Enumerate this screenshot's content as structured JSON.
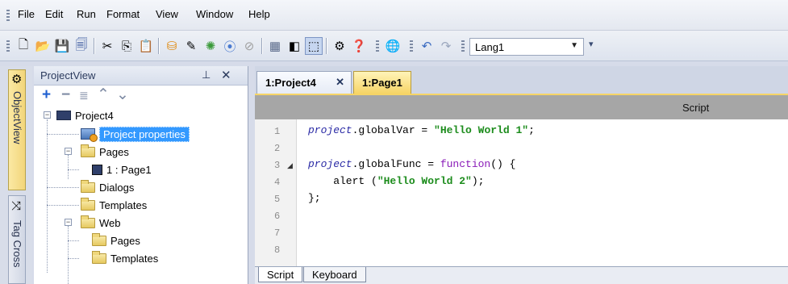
{
  "menu": [
    "File",
    "Edit",
    "Run",
    "Format",
    "View",
    "Window",
    "Help"
  ],
  "toolbar": {
    "icons": [
      "new-icon",
      "open-icon",
      "save-icon",
      "save-all-icon",
      "cut-icon",
      "copy-icon",
      "paste-icon",
      "run-icon",
      "edit-icon",
      "debug-icon",
      "play-icon",
      "stop-icon",
      "grid-icon",
      "align-icon",
      "select-icon",
      "properties-icon",
      "help-icon",
      "globe-icon",
      "undo-icon",
      "redo-icon"
    ],
    "language": "Lang1"
  },
  "sidebar": {
    "tabs": [
      "ObjectView",
      "Tag Cross"
    ]
  },
  "project_view": {
    "title": "ProjectView",
    "tree": [
      {
        "label": "Project4",
        "level": 0,
        "expanded": true,
        "icon": "monitor-icon"
      },
      {
        "label": "Project properties",
        "level": 1,
        "selected": true,
        "icon": "properties-icon"
      },
      {
        "label": "Pages",
        "level": 1,
        "expanded": true,
        "icon": "folder-icon"
      },
      {
        "label": "1 : Page1",
        "level": 2,
        "icon": "page-icon"
      },
      {
        "label": "Dialogs",
        "level": 1,
        "icon": "folder-icon"
      },
      {
        "label": "Templates",
        "level": 1,
        "icon": "folder-icon"
      },
      {
        "label": "Web",
        "level": 1,
        "expanded": true,
        "icon": "folder-icon"
      },
      {
        "label": "Pages",
        "level": 2,
        "icon": "folder-icon"
      },
      {
        "label": "Templates",
        "level": 2,
        "icon": "folder-icon"
      }
    ]
  },
  "editor": {
    "tabs": [
      {
        "label": "1:Project4",
        "active": true
      },
      {
        "label": "1:Page1",
        "active": false
      }
    ],
    "header": "Script",
    "line_numbers": [
      "1",
      "2",
      "3",
      "4",
      "5",
      "6",
      "7",
      "8"
    ],
    "code": [
      [
        {
          "t": "project",
          "c": "kw"
        },
        {
          "t": ".globalVar = ",
          "c": ""
        },
        {
          "t": "\"Hello World 1\"",
          "c": "str"
        },
        {
          "t": ";",
          "c": ""
        }
      ],
      [],
      [
        {
          "t": "project",
          "c": "kw"
        },
        {
          "t": ".globalFunc = ",
          "c": ""
        },
        {
          "t": "function",
          "c": "fn"
        },
        {
          "t": "() {",
          "c": ""
        }
      ],
      [
        {
          "t": "    alert (",
          "c": ""
        },
        {
          "t": "\"Hello World 2\"",
          "c": "str"
        },
        {
          "t": ");",
          "c": ""
        }
      ],
      [
        {
          "t": "};",
          "c": ""
        }
      ],
      [],
      [],
      []
    ],
    "bottom_tabs": [
      "Script",
      "Keyboard"
    ]
  }
}
